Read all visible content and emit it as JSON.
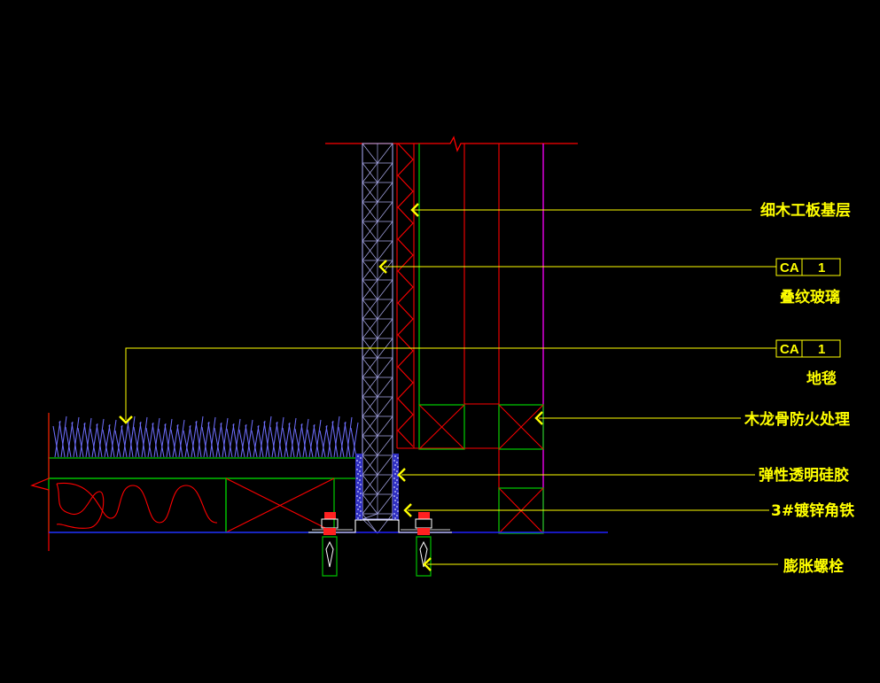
{
  "colors": {
    "background": "#000000",
    "leader": "#ffff00",
    "label": "#ffff00",
    "arrow": "#ffff00",
    "wall_line": "#ff0000",
    "green": "#00c000",
    "blue": "#2020ff",
    "magenta": "#ff00ff",
    "carpet": "#6f6fff",
    "hatch": "#c8c8ff"
  },
  "labels": {
    "wood_base": "细木工板基层",
    "glass": "叠纹玻璃",
    "carpet": "地毯",
    "keel": "木龙骨防火处理",
    "sealant": "弹性透明硅胶",
    "angle_iron": "3#镀锌角铁",
    "bolt": "膨胀螺栓"
  },
  "tags": {
    "glass": {
      "code": "CA",
      "num": "1"
    },
    "carpet": {
      "code": "CA",
      "num": "1"
    }
  }
}
